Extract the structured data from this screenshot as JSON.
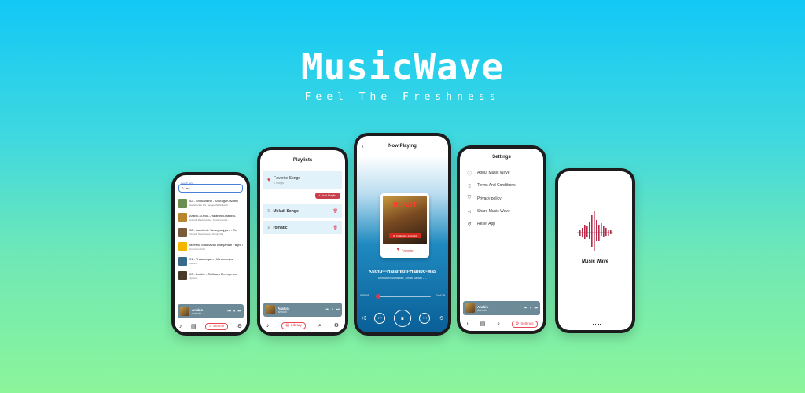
{
  "hero": {
    "title": "MusicWave",
    "tagline": "Feel The Freshness"
  },
  "colors": {
    "accent": "#e03a4a",
    "mini_player_bg": "#6d8a98",
    "playlist_row_bg": "#e2f2fb",
    "bg_top": "#12c8f6",
    "bg_bottom": "#8cf59a"
  },
  "search_screen": {
    "label": "search here",
    "query": "ara",
    "songs": [
      {
        "title": "02 - Shubarathri - AnuragaKilivathil",
        "artist": "Harishankar KS, Sangeetha Srikanth",
        "art_color": "#6b8f4e"
      },
      {
        "title": "Arabic-Kuthu---Halamithi-Habibo-",
        "artist": "Anirudh Ravichander, Jonita Gandhi - ...",
        "art_color": "#b8862e"
      },
      {
        "title": "02 - Jacobinte Swargarajyam - Ee",
        "artist": "Vineeth Sreenivasan, Ranjin Raj",
        "art_color": "#7a5a3a"
      },
      {
        "title": "Meesha Madhavan Aranjanam / Bgm /",
        "artist": "Unknown Artist",
        "art_color": "#f2b600"
      },
      {
        "title": "01 - Thaarangam - Minunnuvoe",
        "artist": "Kavitha",
        "art_color": "#3a6a8a"
      },
      {
        "title": "03 - Lucifer - Raftaara Meenge.co",
        "artist": "Jyotsna",
        "art_color": "#4a3a2a"
      }
    ],
    "mini_player": {
      "title": "Arabic-",
      "artist": "Anirudh"
    },
    "nav_active": "Search"
  },
  "playlists_screen": {
    "title": "Playlists",
    "favorite": {
      "name": "Favorite Songs",
      "count": "0 Songs"
    },
    "add_button": "Add Playlist",
    "playlists": [
      "Meladi Songs",
      "romatic"
    ],
    "mini_player": {
      "title": "Arabic-",
      "artist": "Anirudh"
    },
    "nav_active": "Library"
  },
  "now_playing_screen": {
    "title": "Now Playing",
    "album_title": "BEAST",
    "album_date": "IN CINEMAS 13.04.22",
    "favorite_label": "Favorite",
    "song": "Kuthu---Halamithi-Habibo-Mas",
    "artist": "Anirudh Ravichander, Jonita Gandhi - ...",
    "elapsed": "0:00:01",
    "total": "0:04:39",
    "progress": 0.02
  },
  "settings_screen": {
    "title": "Settings",
    "items": [
      {
        "label": "About Music Wave",
        "icon": "info-icon"
      },
      {
        "label": "Terms And Conditions",
        "icon": "document-icon"
      },
      {
        "label": "Privacy policy",
        "icon": "shield-icon"
      },
      {
        "label": "Share Music Wave",
        "icon": "share-icon"
      },
      {
        "label": "Reset App",
        "icon": "reset-icon"
      }
    ],
    "mini_player": {
      "title": "Arabic-",
      "artist": "Anirudh"
    },
    "nav_active": "Settings"
  },
  "splash_screen": {
    "app_name": "Music Wave"
  }
}
